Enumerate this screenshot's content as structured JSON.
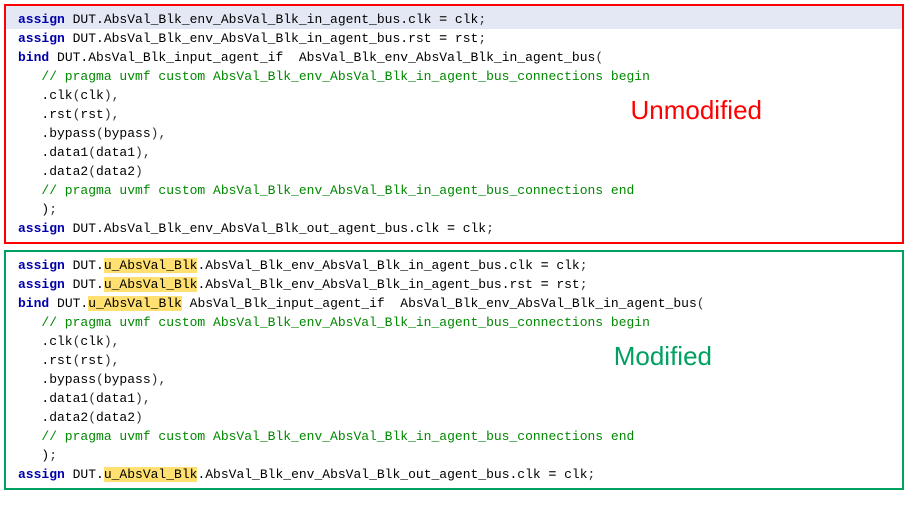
{
  "labels": {
    "unmodified": "Unmodified",
    "modified": "Modified"
  },
  "keywords": {
    "assign": "assign",
    "bind": "bind"
  },
  "highlight": "u_AbsVal_Blk",
  "unmod": {
    "l1_a": " DUT.AbsVal_Blk_env_AbsVal_Blk_in_agent_bus.clk ",
    "l1_eq": "=",
    "l1_b": " clk",
    "semi": ";",
    "l2_a": " DUT.AbsVal_Blk_env_AbsVal_Blk_in_agent_bus.rst ",
    "l2_b": " rst",
    "l3_a": " DUT.AbsVal_Blk_input_agent_if  AbsVal_Blk_env_AbsVal_Blk_in_agent_bus",
    "open": "(",
    "close": ")",
    "comment_begin": "   // pragma uvmf custom AbsVal_Blk_env_AbsVal_Blk_in_agent_bus_connections begin",
    "p_clk": "   .clk",
    "a_clk": "clk",
    "comma": ",",
    "p_rst": "   .rst",
    "a_rst": "rst",
    "p_bypass": "   .bypass",
    "a_bypass": "bypass",
    "p_data1": "   .data1",
    "a_data1": "data1",
    "p_data2": "   .data2",
    "a_data2": "data2",
    "comment_end": "   // pragma uvmf custom AbsVal_Blk_env_AbsVal_Blk_in_agent_bus_connections end",
    "close_indent": "   )",
    "l_last_a": " DUT.AbsVal_Blk_env_AbsVal_Blk_out_agent_bus.clk ",
    "l_last_b": " clk"
  },
  "mod": {
    "l1_pre": " DUT.",
    "l1_post": ".AbsVal_Blk_env_AbsVal_Blk_in_agent_bus.clk ",
    "l1_b": " clk",
    "l2_post": ".AbsVal_Blk_env_AbsVal_Blk_in_agent_bus.rst ",
    "l2_b": " rst",
    "l3_post": " AbsVal_Blk_input_agent_if  AbsVal_Blk_env_AbsVal_Blk_in_agent_bus",
    "comment_begin": "   // pragma uvmf custom AbsVal_Blk_env_AbsVal_Blk_in_agent_bus_connections begin",
    "p_clk": "   .clk",
    "a_clk": "clk",
    "p_rst": "   .rst",
    "a_rst": "rst",
    "p_bypass": "   .bypass",
    "a_bypass": "bypass",
    "p_data1": "   .data1",
    "a_data1": "data1",
    "p_data2": "   .data2",
    "a_data2": "data2",
    "comment_end": "   // pragma uvmf custom AbsVal_Blk_env_AbsVal_Blk_in_agent_bus_connections end",
    "close_indent": "   )",
    "l_last_post": ".AbsVal_Blk_env_AbsVal_Blk_out_agent_bus.clk ",
    "l_last_b": " clk"
  }
}
